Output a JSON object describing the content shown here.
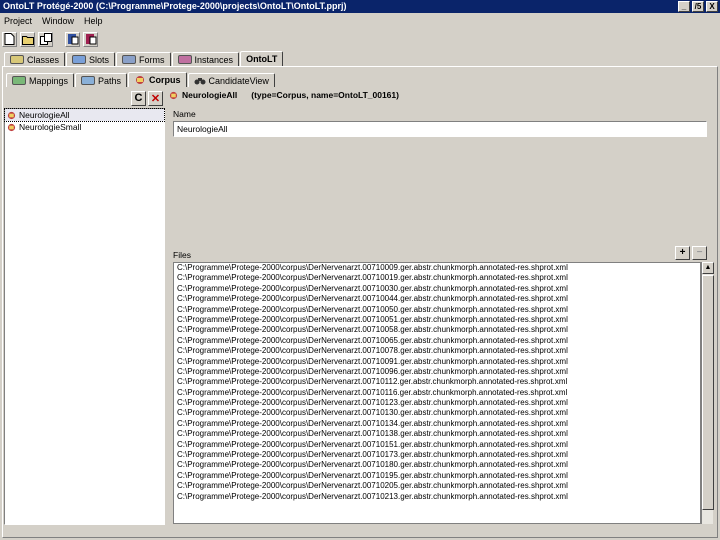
{
  "window": {
    "title": "OntoLT Protégé-2000   (C:\\Programme\\Protege-2000\\projects\\OntoLT\\OntoLT.pprj)",
    "buttons": [
      "_",
      "/5",
      "X"
    ]
  },
  "menu": {
    "items": [
      "Project",
      "Window",
      "Help"
    ]
  },
  "main_tabs": [
    {
      "label": "Classes",
      "icon": "classes-icon",
      "color": "#d8c878"
    },
    {
      "label": "Slots",
      "icon": "slots-icon",
      "color": "#7aa0d8"
    },
    {
      "label": "Forms",
      "icon": "forms-icon",
      "color": "#8aa0c8"
    },
    {
      "label": "Instances",
      "icon": "instances-icon",
      "color": "#c070a0"
    },
    {
      "label": "OntoLT",
      "icon": "",
      "color": ""
    }
  ],
  "sub_tabs": [
    {
      "label": "Mappings",
      "icon": "mappings-icon"
    },
    {
      "label": "Paths",
      "icon": "paths-icon"
    },
    {
      "label": "Corpus",
      "icon": "corpus-icon"
    },
    {
      "label": "CandidateView",
      "icon": "binoculars-icon"
    }
  ],
  "left": {
    "buttons": {
      "create": "C",
      "delete": "✕"
    },
    "items": [
      "NeurologieAll",
      "NeurologieSmall"
    ],
    "selected_index": 0
  },
  "right": {
    "header": {
      "name": "NeurologieAll",
      "meta": "(type=Corpus, name=OntoLT_00161)"
    },
    "name_label": "Name",
    "name_value": "NeurologieAll",
    "files_label": "Files",
    "files_add": "+",
    "files_remove": "−",
    "files": [
      "C:\\Programme\\Protege-2000\\corpus\\DerNervenarzt.00710009.ger.abstr.chunkmorph.annotated-res.shprot.xml",
      "C:\\Programme\\Protege-2000\\corpus\\DerNervenarzt.00710019.ger.abstr.chunkmorph.annotated-res.shprot.xml",
      "C:\\Programme\\Protege-2000\\corpus\\DerNervenarzt.00710030.ger.abstr.chunkmorph.annotated-res.shprot.xml",
      "C:\\Programme\\Protege-2000\\corpus\\DerNervenarzt.00710044.ger.abstr.chunkmorph.annotated-res.shprot.xml",
      "C:\\Programme\\Protege-2000\\corpus\\DerNervenarzt.00710050.ger.abstr.chunkmorph.annotated-res.shprot.xml",
      "C:\\Programme\\Protege-2000\\corpus\\DerNervenarzt.00710051.ger.abstr.chunkmorph.annotated-res.shprot.xml",
      "C:\\Programme\\Protege-2000\\corpus\\DerNervenarzt.00710058.ger.abstr.chunkmorph.annotated-res.shprot.xml",
      "C:\\Programme\\Protege-2000\\corpus\\DerNervenarzt.00710065.ger.abstr.chunkmorph.annotated-res.shprot.xml",
      "C:\\Programme\\Protege-2000\\corpus\\DerNervenarzt.00710078.ger.abstr.chunkmorph.annotated-res.shprot.xml",
      "C:\\Programme\\Protege-2000\\corpus\\DerNervenarzt.00710091.ger.abstr.chunkmorph.annotated-res.shprot.xml",
      "C:\\Programme\\Protege-2000\\corpus\\DerNervenarzt.00710096.ger.abstr.chunkmorph.annotated-res.shprot.xml",
      "C:\\Programme\\Protege-2000\\corpus\\DerNervenarzt.00710112.ger.abstr.chunkmorph.annotated-res.shprot.xml",
      "C:\\Programme\\Protege-2000\\corpus\\DerNervenarzt.00710116.ger.abstr.chunkmorph.annotated-res.shprot.xml",
      "C:\\Programme\\Protege-2000\\corpus\\DerNervenarzt.00710123.ger.abstr.chunkmorph.annotated-res.shprot.xml",
      "C:\\Programme\\Protege-2000\\corpus\\DerNervenarzt.00710130.ger.abstr.chunkmorph.annotated-res.shprot.xml",
      "C:\\Programme\\Protege-2000\\corpus\\DerNervenarzt.00710134.ger.abstr.chunkmorph.annotated-res.shprot.xml",
      "C:\\Programme\\Protege-2000\\corpus\\DerNervenarzt.00710138.ger.abstr.chunkmorph.annotated-res.shprot.xml",
      "C:\\Programme\\Protege-2000\\corpus\\DerNervenarzt.00710151.ger.abstr.chunkmorph.annotated-res.shprot.xml",
      "C:\\Programme\\Protege-2000\\corpus\\DerNervenarzt.00710173.ger.abstr.chunkmorph.annotated-res.shprot.xml",
      "C:\\Programme\\Protege-2000\\corpus\\DerNervenarzt.00710180.ger.abstr.chunkmorph.annotated-res.shprot.xml",
      "C:\\Programme\\Protege-2000\\corpus\\DerNervenarzt.00710195.ger.abstr.chunkmorph.annotated-res.shprot.xml",
      "C:\\Programme\\Protege-2000\\corpus\\DerNervenarzt.00710205.ger.abstr.chunkmorph.annotated-res.shprot.xml",
      "C:\\Programme\\Protege-2000\\corpus\\DerNervenarzt.00710213.ger.abstr.chunkmorph.annotated-res.shprot.xml"
    ]
  }
}
